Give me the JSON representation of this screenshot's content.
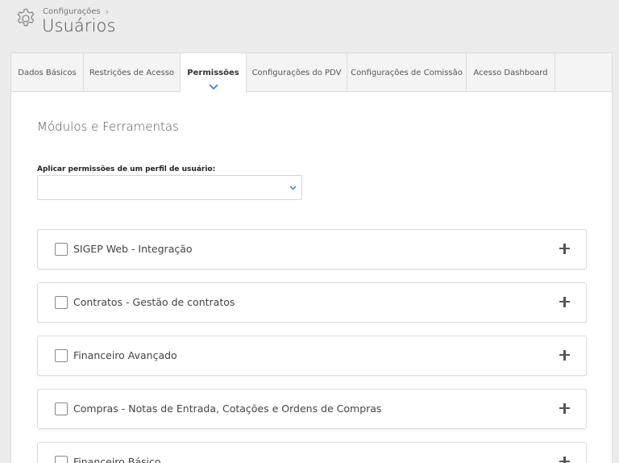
{
  "header": {
    "breadcrumb": "Configurações",
    "title": "Usuários"
  },
  "tabs": [
    {
      "label": "Dados Básicos",
      "active": false
    },
    {
      "label": "Restrições de Acesso",
      "active": false
    },
    {
      "label": "Permissões",
      "active": true
    },
    {
      "label": "Configurações do PDV",
      "active": false
    },
    {
      "label": "Configurações de Comissão",
      "active": false
    },
    {
      "label": "Acesso Dashboard",
      "active": false
    }
  ],
  "content": {
    "section_title": "Módulos e Ferramentas",
    "profile_label": "Aplicar permissões de um perfil de usuário:",
    "profile_value": "",
    "modules": [
      {
        "label": "SIGEP Web - Integração",
        "checked": false
      },
      {
        "label": "Contratos - Gestão de contratos",
        "checked": false
      },
      {
        "label": "Financeiro Avançado",
        "checked": false
      },
      {
        "label": "Compras - Notas de Entrada, Cotações e Ordens de Compras",
        "checked": false
      },
      {
        "label": "Financeiro Básico",
        "checked": false
      }
    ]
  },
  "colors": {
    "accent": "#2a7fd4",
    "background": "#ececec",
    "panel": "#ffffff"
  }
}
